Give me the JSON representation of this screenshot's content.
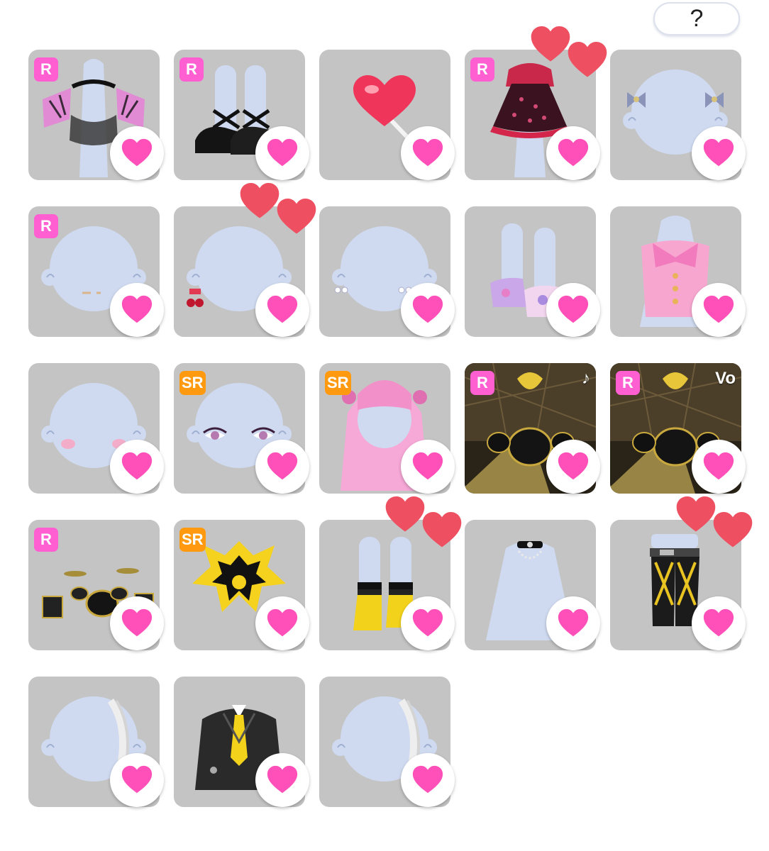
{
  "help_button": {
    "label": "?"
  },
  "colors": {
    "card_bg": "#c4c4c4",
    "heart_pink": "#ff4fb8",
    "badge_r": "#ff5fd0",
    "badge_sr": "#ff9a10",
    "float_heart": "#ee4f61",
    "avatar_base": "#cfdaf0"
  },
  "items": [
    {
      "rarity": "R",
      "art": "butterfly-cape-icon",
      "favorited": false,
      "float_hearts": false,
      "corner_label": null
    },
    {
      "rarity": "R",
      "art": "black-mary-jane-shoes-icon",
      "favorited": false,
      "float_hearts": false,
      "corner_label": null
    },
    {
      "rarity": null,
      "art": "heart-lollipop-icon",
      "favorited": false,
      "float_hearts": false,
      "corner_label": null
    },
    {
      "rarity": "R",
      "art": "polka-dot-dress-icon",
      "favorited": true,
      "float_hearts": true,
      "corner_label": null
    },
    {
      "rarity": null,
      "art": "bow-hair-clips-icon",
      "favorited": false,
      "float_hearts": false,
      "corner_label": null
    },
    {
      "rarity": "R",
      "art": "face-accessory-icon",
      "favorited": false,
      "float_hearts": false,
      "corner_label": null
    },
    {
      "rarity": null,
      "art": "cherry-earring-icon",
      "favorited": true,
      "float_hearts": true,
      "corner_label": null
    },
    {
      "rarity": null,
      "art": "pearl-earring-icon",
      "favorited": false,
      "float_hearts": false,
      "corner_label": null
    },
    {
      "rarity": null,
      "art": "pastel-sandals-icon",
      "favorited": false,
      "float_hearts": false,
      "corner_label": null
    },
    {
      "rarity": null,
      "art": "pink-bow-top-icon",
      "favorited": false,
      "float_hearts": false,
      "corner_label": null
    },
    {
      "rarity": null,
      "art": "blush-makeup-icon",
      "favorited": false,
      "float_hearts": false,
      "corner_label": null
    },
    {
      "rarity": "SR",
      "art": "eyes-makeup-icon",
      "favorited": false,
      "float_hearts": false,
      "corner_label": null
    },
    {
      "rarity": "SR",
      "art": "pink-twin-tail-hair-icon",
      "favorited": false,
      "float_hearts": false,
      "corner_label": null
    },
    {
      "rarity": "R",
      "art": "drum-stage-background-icon",
      "favorited": false,
      "float_hearts": false,
      "corner_label": "♪"
    },
    {
      "rarity": "R",
      "art": "drum-stage-background-icon",
      "favorited": false,
      "float_hearts": false,
      "corner_label": "Vo"
    },
    {
      "rarity": "R",
      "art": "drum-kit-icon",
      "favorited": false,
      "float_hearts": false,
      "corner_label": null
    },
    {
      "rarity": "SR",
      "art": "yellow-emblem-icon",
      "favorited": false,
      "float_hearts": false,
      "corner_label": null
    },
    {
      "rarity": null,
      "art": "yellow-boots-icon",
      "favorited": true,
      "float_hearts": true,
      "corner_label": null
    },
    {
      "rarity": null,
      "art": "choker-necklace-icon",
      "favorited": false,
      "float_hearts": false,
      "corner_label": null
    },
    {
      "rarity": null,
      "art": "black-yellow-pants-icon",
      "favorited": true,
      "float_hearts": true,
      "corner_label": null
    },
    {
      "rarity": null,
      "art": "silver-hair-strand-icon",
      "favorited": false,
      "float_hearts": false,
      "corner_label": null
    },
    {
      "rarity": null,
      "art": "black-jacket-tie-icon",
      "favorited": false,
      "float_hearts": false,
      "corner_label": null
    },
    {
      "rarity": null,
      "art": "silver-hair-strand-icon",
      "favorited": false,
      "float_hearts": false,
      "corner_label": null
    }
  ]
}
